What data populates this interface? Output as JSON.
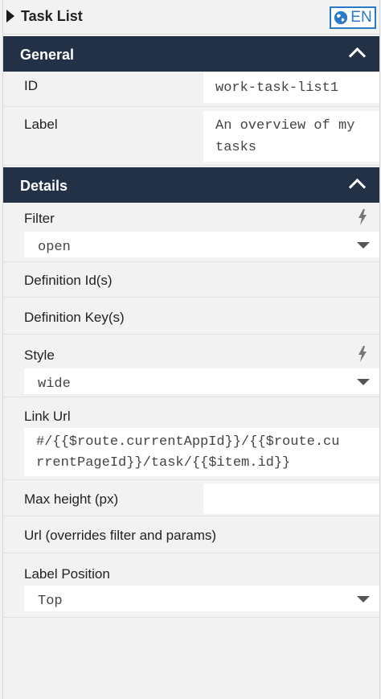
{
  "header": {
    "title": "Task List",
    "lang_label": "EN"
  },
  "general": {
    "title": "General",
    "id": {
      "label": "ID",
      "value": "work-task-list1"
    },
    "label": {
      "label": "Label",
      "value_line1": "An overview of my",
      "value_line2": "tasks"
    }
  },
  "details": {
    "title": "Details",
    "filter": {
      "label": "Filter",
      "value": "open"
    },
    "definition_ids": {
      "label": "Definition Id(s)"
    },
    "definition_keys": {
      "label": "Definition Key(s)"
    },
    "style": {
      "label": "Style",
      "value": "wide"
    },
    "link_url": {
      "label": "Link Url",
      "value_line1": "#/{{$route.currentAppId}}/{{$route.cu",
      "value_line2": "rrentPageId}}/task/{{$item.id}}"
    },
    "max_height": {
      "label": "Max height (px)",
      "value": ""
    },
    "url": {
      "label": "Url (overrides filter and params)"
    },
    "label_position": {
      "label": "Label Position",
      "value": "Top"
    }
  },
  "icons": [
    "collapse-triangle-icon",
    "globe-icon",
    "chevron-up-icon",
    "lightning-bolt-icon",
    "dropdown-caret-icon"
  ]
}
